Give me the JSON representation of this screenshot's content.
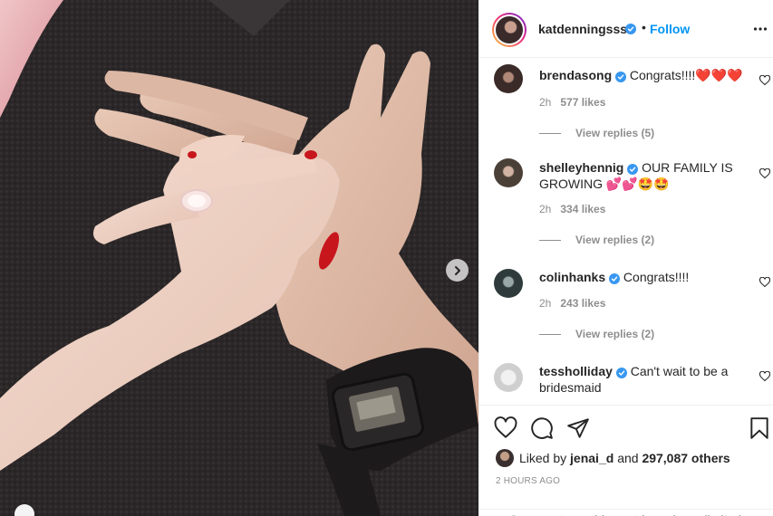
{
  "post": {
    "photo_alt": "",
    "header": {
      "username": "katdenningsss",
      "separator": "•",
      "follow_label": "Follow",
      "more_icon": "more-horizontal-icon"
    },
    "comments": [
      {
        "username": "brendasong",
        "verified": true,
        "text": "Congrats!!!!❤️❤️❤️",
        "age": "2h",
        "likes": "577 likes",
        "replies": "View replies (5)"
      },
      {
        "username": "shelleyhennig",
        "verified": true,
        "text": "OUR FAMILY IS GROWING 💕💕🤩🤩",
        "age": "2h",
        "likes": "334 likes",
        "replies": "View replies (2)"
      },
      {
        "username": "colinhanks",
        "verified": true,
        "text": "Congrats!!!!",
        "age": "2h",
        "likes": "243 likes",
        "replies": "View replies (2)"
      },
      {
        "username": "tessholliday",
        "verified": true,
        "text": "Can't wait to be a bridesmaid",
        "age": "",
        "likes": "",
        "replies": ""
      }
    ],
    "actions": {
      "like_icon": "heart-icon",
      "comment_icon": "comment-icon",
      "share_icon": "paper-plane-icon",
      "save_icon": "bookmark-icon"
    },
    "liked_by": {
      "prefix": "Liked by",
      "user": "jenai_d",
      "conjunction": "and",
      "others": "297,087 others"
    },
    "timestamp": "2 HOURS AGO",
    "comments_limited": "Comments on this post have been limited."
  },
  "colors": {
    "link_blue": "#0095f6",
    "verified_blue": "#3897f0",
    "muted_gray": "#8e8e8e",
    "text_dark": "#262626"
  }
}
